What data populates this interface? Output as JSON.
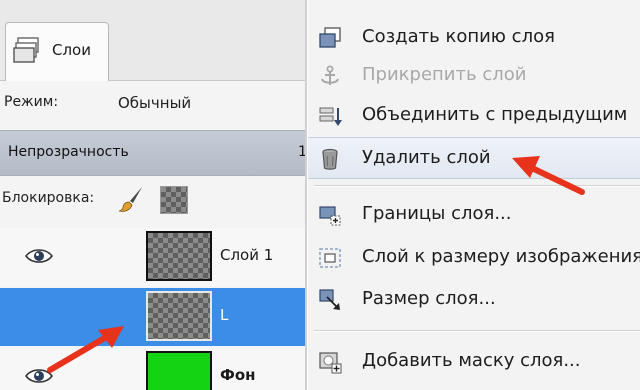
{
  "layers_panel": {
    "tab_label": "Слои",
    "mode_label": "Режим:",
    "mode_value": "Обычный",
    "opacity_label": "Непрозрачность",
    "opacity_value": "1",
    "lock_label": "Блокировка:",
    "layers": [
      {
        "name": "Слой 1",
        "visible": true,
        "selected": false,
        "thumbnail": "checker"
      },
      {
        "name": "L",
        "visible": false,
        "selected": true,
        "thumbnail": "checker"
      },
      {
        "name": "Фон",
        "visible": true,
        "selected": false,
        "thumbnail": "green"
      }
    ]
  },
  "context_menu": {
    "items": [
      {
        "label": "Создать копию слоя",
        "icon": "duplicate-layer-icon",
        "enabled": true
      },
      {
        "label": "Прикрепить слой",
        "icon": "anchor-icon",
        "enabled": false
      },
      {
        "label": "Объединить с предыдущим",
        "icon": "merge-down-icon",
        "enabled": true
      },
      {
        "label": "Удалить слой",
        "icon": "trash-icon",
        "enabled": true,
        "highlighted": true
      },
      {
        "label": "Границы слоя...",
        "icon": "layer-boundary-icon",
        "enabled": true
      },
      {
        "label": "Слой к размеру изображения",
        "icon": "layer-to-image-size-icon",
        "enabled": true
      },
      {
        "label": "Размер слоя...",
        "icon": "scale-layer-icon",
        "enabled": true
      },
      {
        "label": "Добавить маску слоя...",
        "icon": "add-mask-icon",
        "enabled": true
      }
    ]
  },
  "colors": {
    "selection": "#3b8de6",
    "arrow": "#e8321c",
    "layer_green": "#13d313",
    "opacity_bar": "#b9c0cb"
  }
}
